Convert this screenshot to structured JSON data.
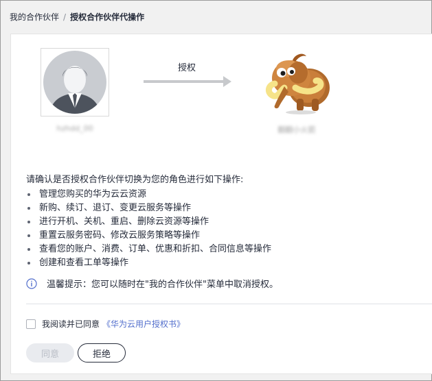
{
  "breadcrumb": {
    "parent": "我的合作伙伴",
    "separator": "/",
    "current": "授权合作伙伴代操作"
  },
  "authorization": {
    "user_name_masked": "hzhdd_00",
    "arrow_label": "授权",
    "partner_name_masked": "翻翻小火箭"
  },
  "confirm": {
    "title": "请确认是否授权合作伙伴切换为您的角色进行如下操作:",
    "operations": [
      "管理您购买的华为云云资源",
      "新购、续订、退订、变更云服务等操作",
      "进行开机、关机、重启、删除云资源等操作",
      "重置云服务密码、修改云服务策略等操作",
      "查看您的账户、消费、订单、优惠和折扣、合同信息等操作",
      "创建和查看工单等操作"
    ],
    "tip": "温馨提示：您可以随时在\"我的合作伙伴\"菜单中取消授权。"
  },
  "agreement": {
    "checked": false,
    "text": "我阅读并已同意",
    "link": "《华为云用户授权书》"
  },
  "buttons": {
    "agree": "同意",
    "reject": "拒绝"
  },
  "colors": {
    "link": "#526ecc",
    "info_icon": "#526ecc",
    "disabled_bg": "#e9ebef"
  },
  "icons": {
    "user_avatar": "default-person-avatar",
    "partner_avatar": "mammoth-avatar",
    "arrow": "right-arrow",
    "tip": "info-circle-icon"
  }
}
